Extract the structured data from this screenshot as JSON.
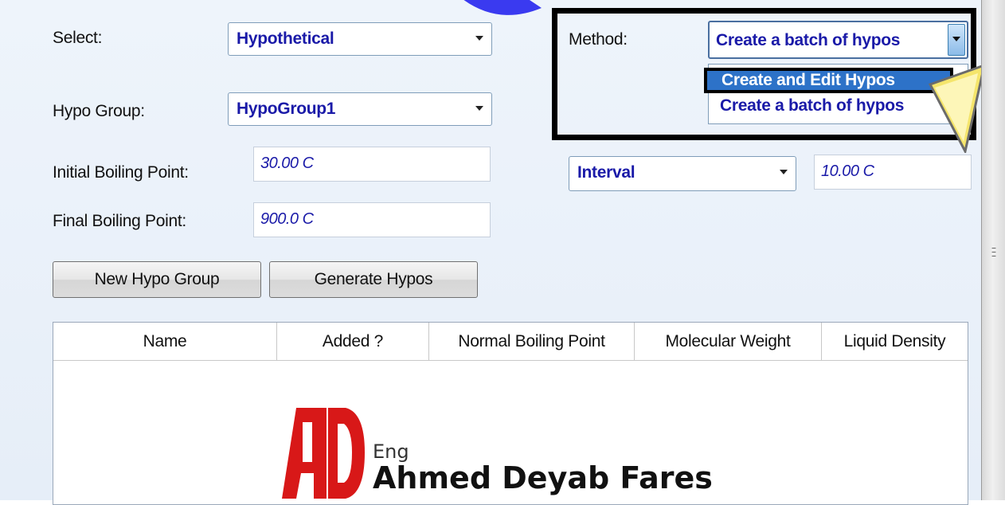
{
  "form": {
    "select_label": "Select:",
    "select_value": "Hypothetical",
    "hypo_group_label": "Hypo Group:",
    "hypo_group_value": "HypoGroup1",
    "initial_bp_label": "Initial Boiling Point:",
    "initial_bp_value": "30.00 C",
    "final_bp_label": "Final Boiling Point:",
    "final_bp_value": "900.0 C",
    "interval_value": "Interval",
    "interval_amount": "10.00 C"
  },
  "method": {
    "label": "Method:",
    "value": "Create a batch of hypos",
    "options": [
      "Create and Edit Hypos",
      "Create a batch of hypos"
    ],
    "highlighted_option": "Create and Edit Hypos"
  },
  "buttons": {
    "new_group": "New Hypo Group",
    "generate": "Generate Hypos"
  },
  "table": {
    "columns": [
      "Name",
      "Added ?",
      "Normal Boiling Point",
      "Molecular Weight",
      "Liquid Density"
    ],
    "rows": []
  },
  "logo": {
    "eng": "Eng",
    "name": "Ahmed Deyab Fares",
    "mark_text": "AD"
  },
  "colors": {
    "value_text": "#1a1aa8",
    "highlight": "#2d72c8",
    "pointer": "#f5e56b",
    "logo_red": "#d81818"
  }
}
